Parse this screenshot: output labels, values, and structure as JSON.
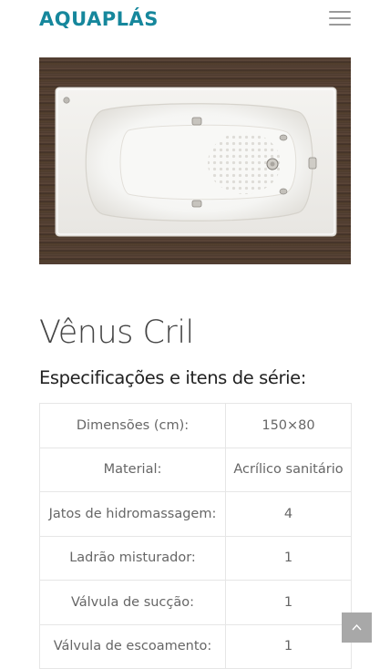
{
  "header": {
    "logo_text": "AQUAPLÁS",
    "menu_icon": "hamburger-menu-icon"
  },
  "product": {
    "image_icon": "bathtub-product-photo",
    "title": "Vênus Cril",
    "spec_heading": "Especificações e itens de série:",
    "specs": [
      {
        "label": "Dimensões (cm):",
        "value": "150×80"
      },
      {
        "label": "Material:",
        "value": "Acrílico sanitário"
      },
      {
        "label": "Jatos de hidromassagem:",
        "value": "4"
      },
      {
        "label": "Ladrão misturador:",
        "value": "1"
      },
      {
        "label": "Válvula de sucção:",
        "value": "1"
      },
      {
        "label": "Válvula de escoamento:",
        "value": "1"
      }
    ]
  },
  "back_to_top": {
    "icon": "chevron-up-icon"
  },
  "colors": {
    "brand": "#16879c",
    "text": "#666666",
    "border": "#e6e6e6",
    "back_to_top_bg": "#a8a8a8"
  }
}
